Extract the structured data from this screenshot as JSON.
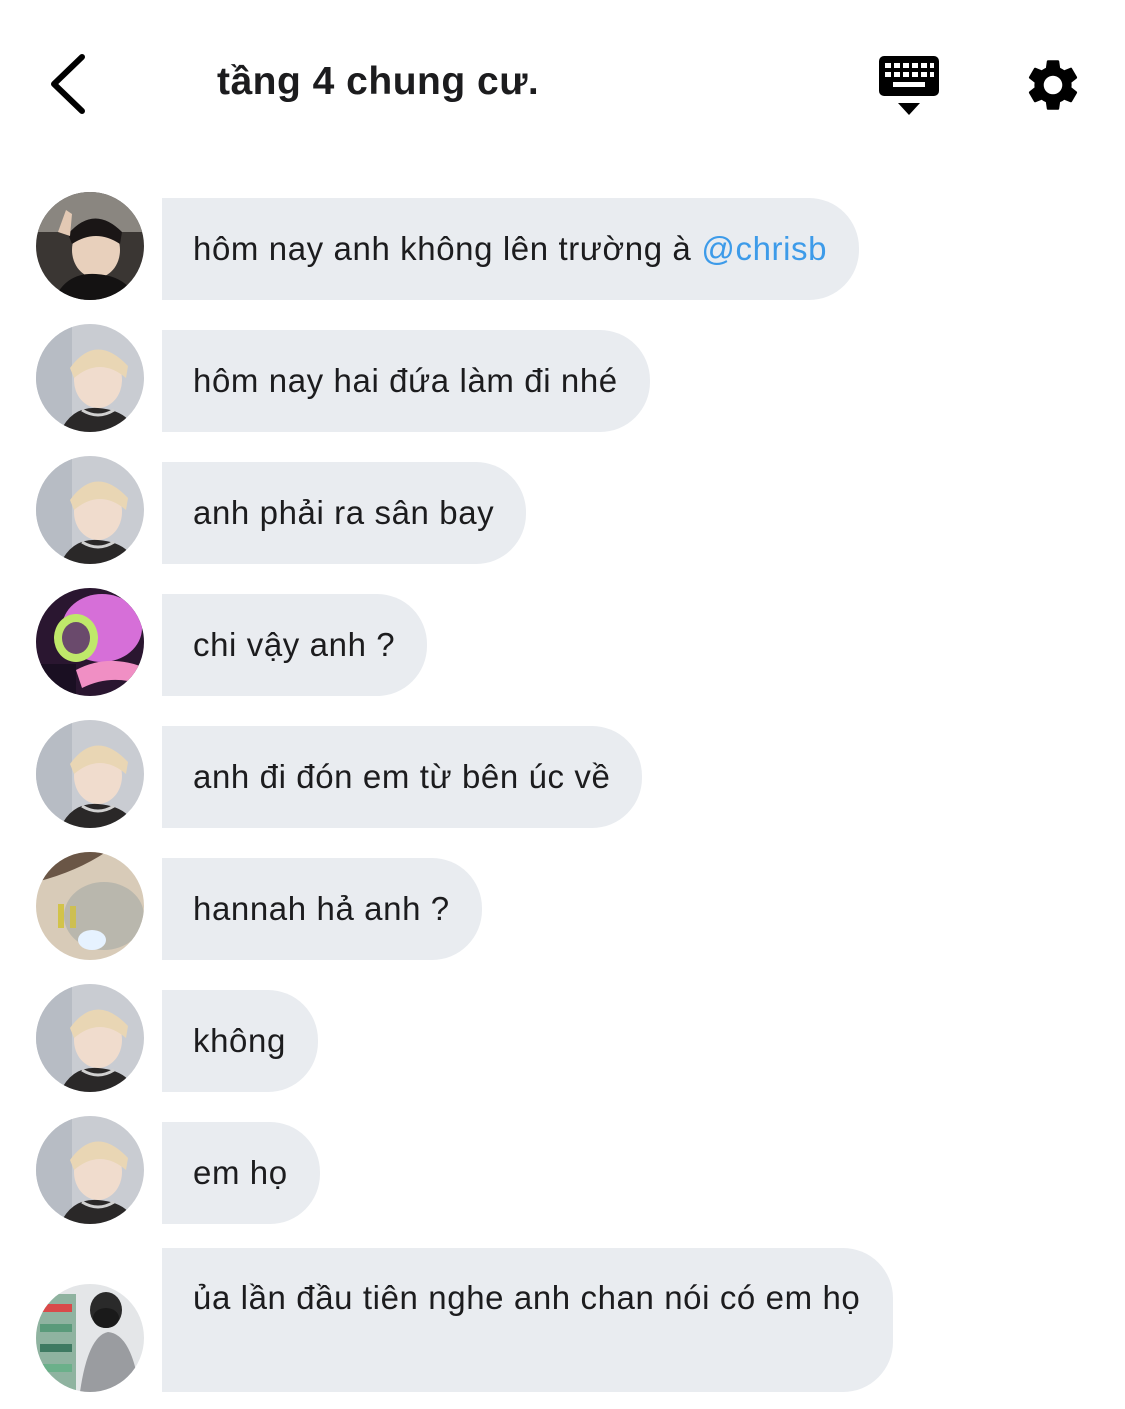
{
  "header": {
    "title": "tầng 4 chung cư.",
    "back_icon": "chevron-left-icon",
    "keyboard_icon": "keyboard-hide-icon",
    "settings_icon": "gear-icon"
  },
  "colors": {
    "bubble_bg": "#e9ecf0",
    "mention": "#3d9be9",
    "text": "#1c1c1e"
  },
  "messages": [
    {
      "avatar": "dark-hair-peace-sign",
      "text": "hôm nay anh không lên trường à",
      "mention": "@chrisb"
    },
    {
      "avatar": "blonde-hair",
      "text": "hôm nay hai đứa làm đi nhé"
    },
    {
      "avatar": "blonde-hair",
      "text": "anh phải ra sân bay"
    },
    {
      "avatar": "pink-neon",
      "text": "chi vậy anh ?"
    },
    {
      "avatar": "blonde-hair",
      "text": "anh đi đón em từ bên úc về"
    },
    {
      "avatar": "sleeping-plush",
      "text": "hannah hả anh ?"
    },
    {
      "avatar": "blonde-hair",
      "text": "không"
    },
    {
      "avatar": "blonde-hair",
      "text": "em họ"
    },
    {
      "avatar": "masked-store",
      "text": "ủa lần đầu tiên nghe anh chan nói có em họ"
    }
  ]
}
